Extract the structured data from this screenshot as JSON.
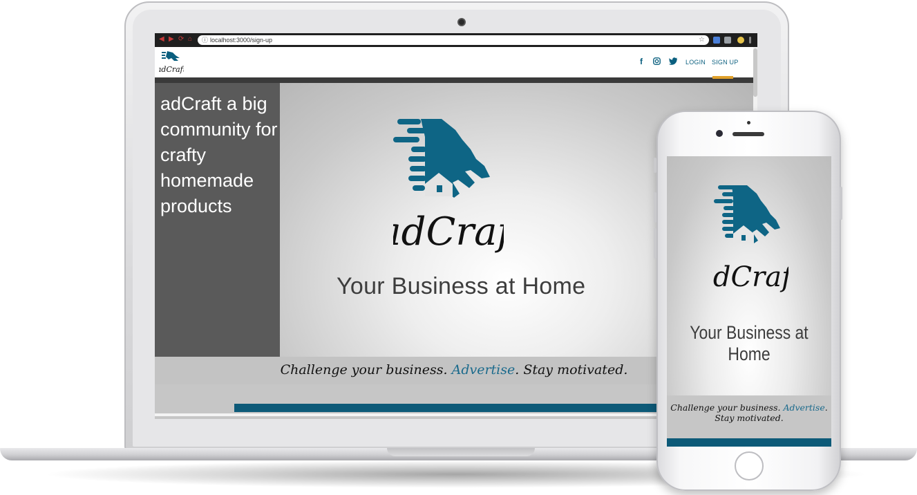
{
  "browser": {
    "url": "localhost:3000/sign-up"
  },
  "nav": {
    "brand": "adCraft",
    "social_icons": [
      "facebook-icon",
      "instagram-icon",
      "twitter-icon"
    ],
    "login_label": "LOGIN",
    "signup_label": "SIGN UP"
  },
  "hero": {
    "sidebar_text": "adCraft a big community for crafty homemade products",
    "logo_wordmark": "adCraft",
    "tagline": "Your Business at Home"
  },
  "slogan": {
    "part1": "Challenge your business. ",
    "accent": "Advertise",
    "part2": ". Stay motivated."
  },
  "phone": {
    "logo_wordmark": "adCraft",
    "tagline": "Your Business at Home",
    "slogan_part1": "Challenge your business. ",
    "slogan_accent": "Advertise",
    "slogan_part2": ". Stay motivated."
  },
  "colors": {
    "brand_teal": "#0d5a78",
    "accent_orange": "#e0a02a",
    "sidebar_gray": "#5a5a5a"
  }
}
